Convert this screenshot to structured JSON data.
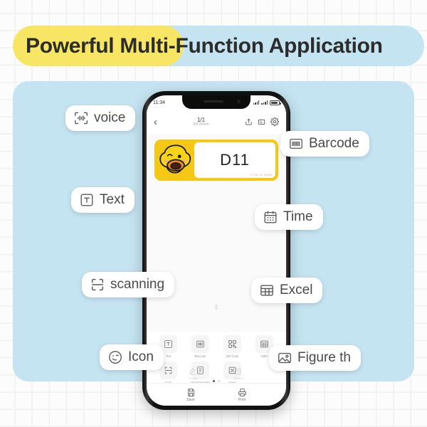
{
  "title": {
    "text": "Powerful Multi-Function Application",
    "highlight_color": "#f7e663",
    "band_color": "#c5e4f1"
  },
  "panel": {
    "background_color": "#c5e4f1"
  },
  "phone": {
    "status_bar": {
      "time": "11:34",
      "battery": "full"
    },
    "header": {
      "back_icon": "chevron-left-icon",
      "page_indicator": "1/1",
      "label_size": "50×30mm",
      "icons": [
        "share-icon",
        "label-template-icon",
        "settings-gear-icon"
      ]
    },
    "label": {
      "text": "D11",
      "copyright": "© '05, 20 SEMK",
      "background_color": "#f5c816",
      "graphic": "duck-character"
    },
    "quick_actions": [
      {
        "label": "Empty",
        "icon": "eraser-icon"
      },
      {
        "label": "Refresh",
        "icon": "refresh-icon"
      }
    ],
    "tools_row1": [
      {
        "label": "Text",
        "icon": "text-tool-icon"
      },
      {
        "label": "Barcode",
        "icon": "barcode-tool-icon"
      },
      {
        "label": "QR Code",
        "icon": "qrcode-tool-icon"
      },
      {
        "label": "Table",
        "icon": "table-tool-icon"
      }
    ],
    "tools_row2": [
      {
        "label": "Scan",
        "icon": "scan-tool-icon"
      },
      {
        "label": "Serial Number",
        "icon": "serial-number-tool-icon"
      },
      {
        "label": "Insert",
        "icon": "insert-tool-icon"
      }
    ],
    "bottom_bar": [
      {
        "label": "Save",
        "icon": "save-floppy-icon"
      },
      {
        "label": "Print",
        "icon": "printer-icon"
      }
    ]
  },
  "chips": [
    {
      "id": "voice",
      "label": "voice",
      "icon": "voice-waveform-icon"
    },
    {
      "id": "text",
      "label": "Text",
      "icon": "text-box-icon"
    },
    {
      "id": "scanning",
      "label": "scanning",
      "icon": "scan-frame-icon"
    },
    {
      "id": "icon",
      "label": "Icon",
      "icon": "smiley-face-icon"
    },
    {
      "id": "barcode",
      "label": "Barcode",
      "icon": "barcode-box-icon"
    },
    {
      "id": "time",
      "label": "Time",
      "icon": "calendar-icon"
    },
    {
      "id": "excel",
      "label": "Excel",
      "icon": "table-grid-icon"
    },
    {
      "id": "figure",
      "label": "Figure th",
      "icon": "picture-image-icon"
    }
  ]
}
